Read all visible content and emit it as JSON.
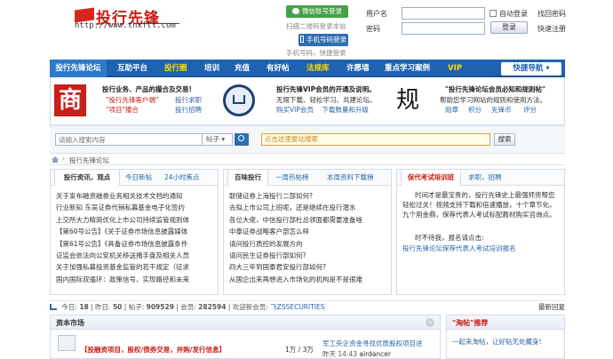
{
  "header": {
    "logo_title": "投行先锋",
    "logo_url": "http://www.thxflt.com",
    "wechat_login": "微信账号登录",
    "wechat_sub": "扫描二维码登录本站",
    "mobile_login": "手机号码登录",
    "mobile_sub": "手机号码，快捷登录",
    "username_label": "用户名",
    "password_label": "密码",
    "auto_login": "自动登录",
    "find_password": "找回密码",
    "login_button": "登录",
    "quick_register": "快速注册"
  },
  "nav": {
    "items": [
      "投行先锋论坛",
      "互助平台",
      "投行圈",
      "培训",
      "充值",
      "有好帖",
      "法规库",
      "许愿墙",
      "重点学习案例",
      "VIP"
    ],
    "guide": "快捷导航 ▾"
  },
  "promo": {
    "left_icon_char": "商",
    "left_title": "投行业务、产品的撮合及交易!",
    "left_links": [
      "\"投行先锋客户端\"",
      "投行求职",
      "\"项目\"播合",
      "投行招聘"
    ],
    "mid_title": "投行先锋VIP会员的开通及说明。",
    "mid_line1": "无限下载、轻松学习、共建论坛。",
    "mid_line2": "购买VIP会员    下载数量和升级",
    "right_icon_char": "规",
    "right_title": "\"投行先锋论坛会员必知和规则帖\"",
    "right_line": "帮助您学习网站的规则和使用方法。",
    "right_links": [
      "勋章",
      "积分",
      "先锋币",
      "评分"
    ]
  },
  "search": {
    "placeholder": "请输入搜索内容",
    "type": "帖子 ▾",
    "hot_placeholder": "点击这里整站搜索",
    "button": "搜索"
  },
  "breadcrumb": "投行先锋论坛",
  "panel1": {
    "tabs": [
      "投行资讯，观点",
      "今日新帖",
      "24小时焦点"
    ],
    "lines": [
      "关于发布融资融券业务相关技术文档的通知",
      "行业新知 东吴证券代销私募基金电子化签约",
      "上交所大力精简优化上市公司持续监管规则体",
      "【第60号公告】《关于证券市场信息披露媒体",
      "【第61号公告】《具备证券市场信息披露条件",
      "证监会依法向公安机关移送掩手盘及相关人员",
      "关于加强私募投资基金监管的若干规定（征求",
      "国内国际双循环：政策信号、实现路径和未来"
    ]
  },
  "panel2": {
    "tabs": [
      "百味投行",
      "一周热帖榜",
      "本周资料下载榜"
    ],
    "lines": [
      "联储证券上海投行二部如何?",
      "去拟上市公司上班呢，还是继续在投行潜水",
      "各位大佬，中信投行部杜总领面都需要准备啥",
      "中泰证券战略客户部怎么样",
      "请问投行质控的发展方向",
      "请问民生证券投行部如何?",
      "四大三年到国泰君安投行部如何?",
      "从国企出来再想进入市场化的机构是不是很难"
    ]
  },
  "panel3": {
    "tabs": [
      "保代考试培训班",
      "求职，招聘"
    ],
    "para1": "时间才是最宝贵的，投行先锋史上最强师资帮您轻松过关！视频支持下载和倍速播放，十个章节化，九个用金鼎，保荐代表人考试标配教材购买咨询点。",
    "para2": "时不待我，报名请点击:",
    "link": "投行先锋论坛保荐代表人考试培训报名"
  },
  "stats": {
    "today_label": "今日:",
    "today": "18",
    "yesterday_label": "昨日:",
    "yesterday": "50",
    "posts_label": "帖子:",
    "posts": "909529",
    "members_label": "会员:",
    "members": "282594",
    "welcome": "欢迎新会员:",
    "new_member": "飞ZSSECURITIES",
    "latest": "最新回复"
  },
  "market": {
    "title": "资本市场",
    "thread": "【投融资项目，股权/债券交易，并购/发行信息】",
    "count": "1万 / 3万",
    "last_title": "军工央企资金寻找优质股权项目进",
    "last_time": "昨天 14:43",
    "last_user": "airdancer"
  },
  "hot": {
    "title": "\"淘帖\"推荐",
    "item": "一起来淘帖，让好贴无处藏身!"
  }
}
